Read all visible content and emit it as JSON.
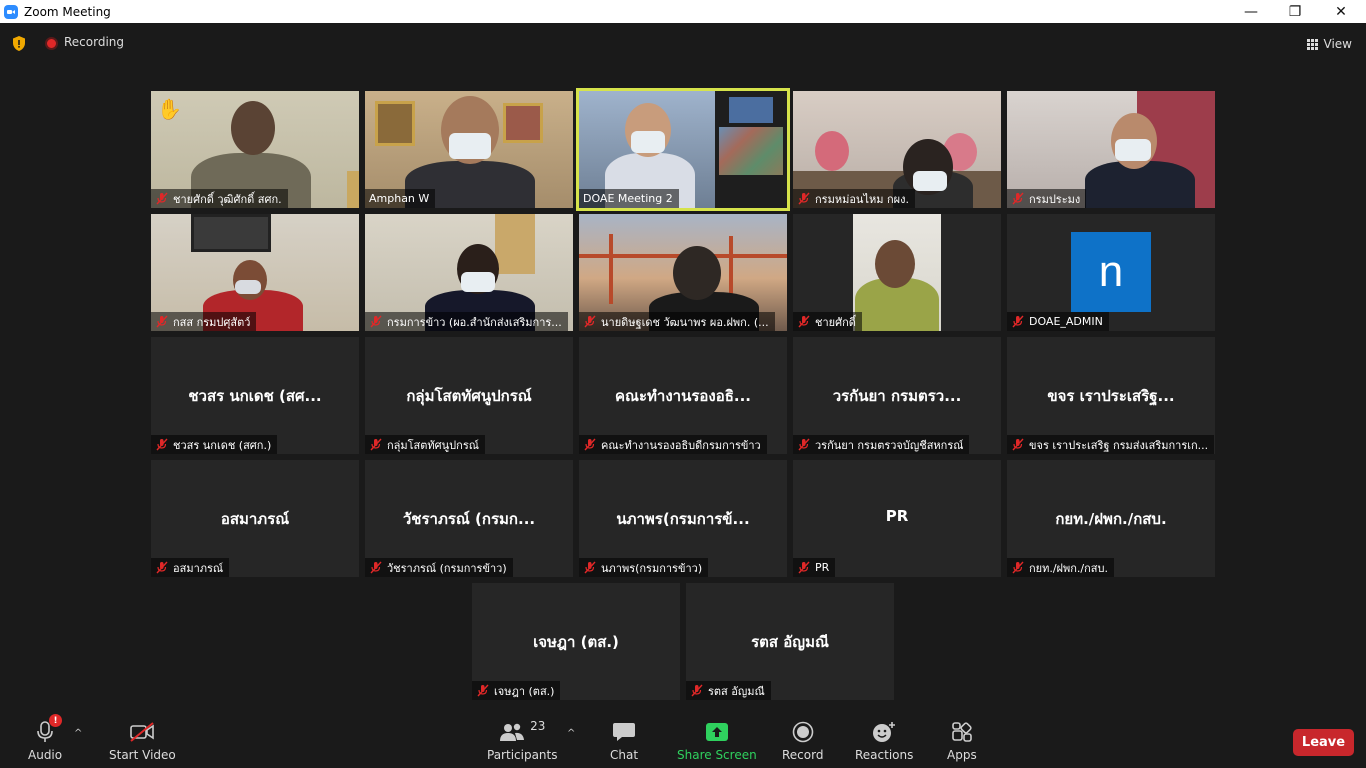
{
  "window": {
    "title": "Zoom Meeting",
    "minimize": "—",
    "maximize": "❐",
    "close": "✕"
  },
  "topbar": {
    "recording_label": "Recording",
    "view_label": "View"
  },
  "video_tiles": [
    {
      "label": "ชายศักดิ์  วุฒิศักดิ์ สศก.",
      "hand": "✋"
    },
    {
      "label": "Amphan W"
    },
    {
      "label": "DOAE Meeting 2"
    },
    {
      "label": "กรมหม่อนไหม กผง."
    },
    {
      "label": "กรมประมง"
    },
    {
      "label": "กสส กรมปศุสัตว์"
    },
    {
      "label": "กรมการข้าว (ผอ.สำนักส่งเสริมการ..."
    },
    {
      "label": "นายดิษฐเดช  วัฒนาพร ผอ.ฝพก. (..."
    },
    {
      "label": "ชายศักดิ์"
    },
    {
      "label": "DOAE_ADMIN",
      "avatar_letter": "n"
    }
  ],
  "name_tiles": [
    {
      "center": "ชวสร นกเดช (สศ...",
      "label": "ชวสร นกเดช (สศก.)"
    },
    {
      "center": "กลุ่มโสตทัศนูปกรณ์",
      "label": "กลุ่มโสตทัศนูปกรณ์"
    },
    {
      "center": "คณะทำงานรองอธิ...",
      "label": "คณะทำงานรองอธิบดีกรมการข้าว"
    },
    {
      "center": "วรกันยา กรมตรว...",
      "label": "วรกันยา กรมตรวจบัญชีสหกรณ์"
    },
    {
      "center": "ขจร เราประเสริฐ...",
      "label": "ขจร เราประเสริฐ กรมส่งเสริมการเก..."
    },
    {
      "center": "อสมาภรณ์",
      "label": "อสมาภรณ์"
    },
    {
      "center": "วัชราภรณ์ (กรมก...",
      "label": "วัชราภรณ์ (กรมการข้าว)"
    },
    {
      "center": "นภาพร(กรมการข้...",
      "label": "นภาพร(กรมการข้าว)"
    },
    {
      "center": "PR",
      "label": "PR"
    },
    {
      "center": "กยท./ฝพก./กสบ.",
      "label": "กยท./ฝพก./กสบ."
    },
    {
      "center": "เจษฎา (ตส.)",
      "label": "เจษฎา (ตส.)"
    },
    {
      "center": "รตส อัญมณี",
      "label": "รตส อัญมณี"
    }
  ],
  "toolbar": {
    "audio": "Audio",
    "audio_badge": "!",
    "start_video": "Start Video",
    "participants": "Participants",
    "participants_count": "23",
    "chat": "Chat",
    "share_screen": "Share Screen",
    "record": "Record",
    "reactions": "Reactions",
    "apps": "Apps",
    "leave": "Leave",
    "caret": "^"
  },
  "colors": {
    "accent_green": "#2fd15e",
    "leave_red": "#c8272c",
    "active_speaker": "#d6e34b",
    "zoom_blue": "#2d8cff"
  }
}
